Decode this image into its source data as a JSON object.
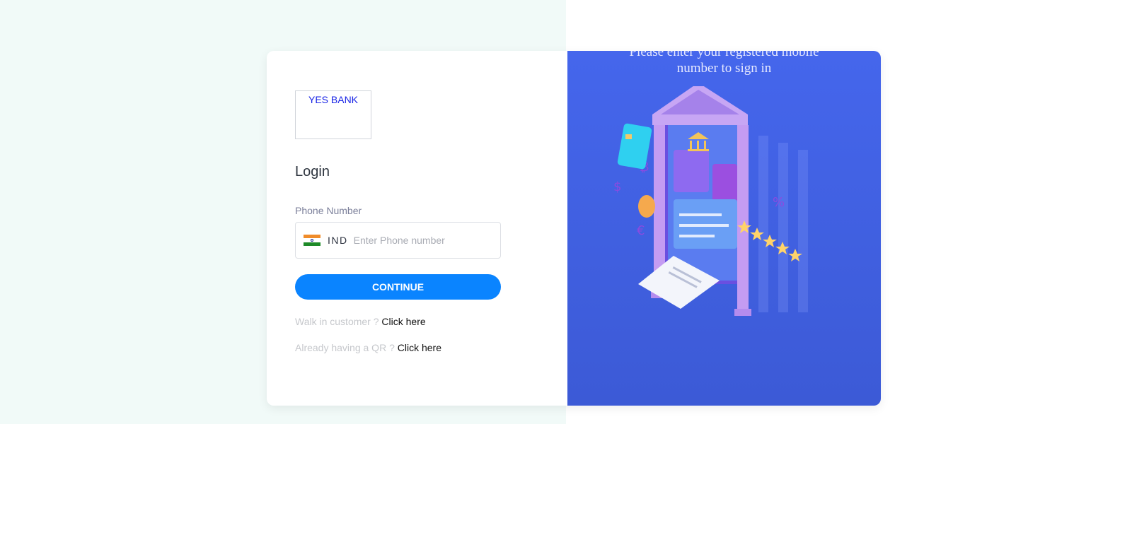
{
  "logo": {
    "text": "YES BANK"
  },
  "form": {
    "title": "Login",
    "phone_label": "Phone Number",
    "country_code": "IND",
    "phone_placeholder": "Enter Phone number",
    "phone_value": "",
    "continue_label": "CONTINUE"
  },
  "links": {
    "walkin_prompt": "Walk in customer ?",
    "walkin_link": "Click here",
    "qr_prompt": "Already having a QR ?",
    "qr_link": "Click here"
  },
  "promo": {
    "caption": "Please enter your registered mobile number to sign in",
    "illustration_icon": "bank-illustration-icon"
  },
  "colors": {
    "accent": "#0a84ff",
    "panel": "#4566ec",
    "background_tint": "#f1faf8"
  }
}
